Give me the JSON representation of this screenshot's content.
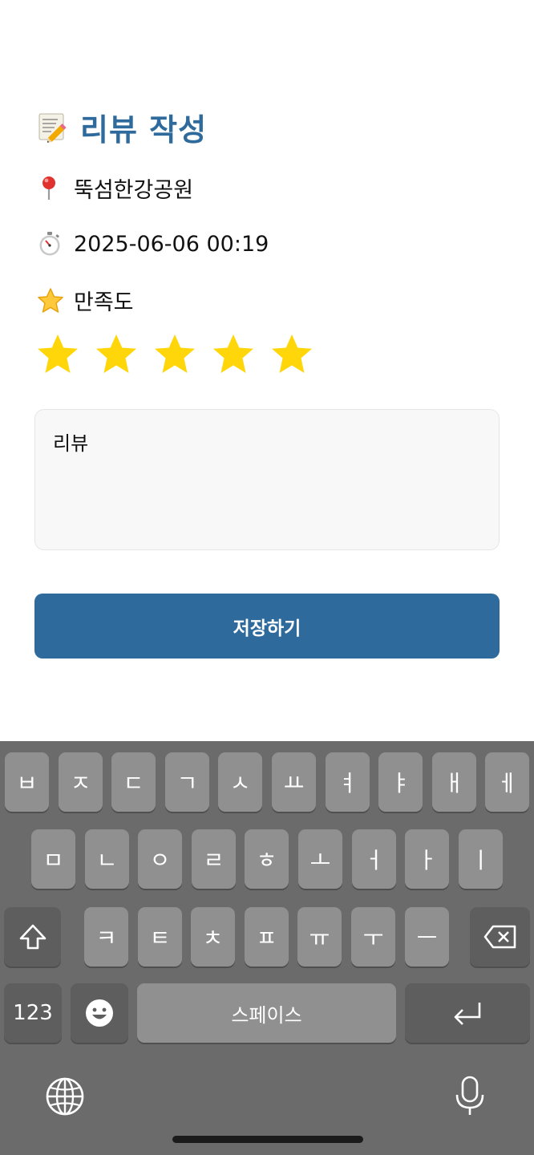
{
  "header": {
    "title": "리뷰 작성",
    "title_color": "#2E6A9B",
    "icon": "memo-icon"
  },
  "place": {
    "icon": "pin-icon",
    "name": "뚝섬한강공원"
  },
  "visit": {
    "icon": "stopwatch-icon",
    "datetime": "2025-06-06 00:19"
  },
  "satisfaction": {
    "icon": "star-icon",
    "label": "만족도",
    "rating": 5,
    "max": 5,
    "star_color": "#FFD60A"
  },
  "review": {
    "placeholder": "리뷰",
    "value": ""
  },
  "save_button": {
    "label": "저장하기",
    "color": "#2E6A9B"
  },
  "keyboard": {
    "row1": [
      "ㅂ",
      "ㅈ",
      "ㄷ",
      "ㄱ",
      "ㅅ",
      "ㅛ",
      "ㅕ",
      "ㅑ",
      "ㅐ",
      "ㅔ"
    ],
    "row2": [
      "ㅁ",
      "ㄴ",
      "ㅇ",
      "ㄹ",
      "ㅎ",
      "ㅗ",
      "ㅓ",
      "ㅏ",
      "ㅣ"
    ],
    "row3": [
      "ㅋ",
      "ㅌ",
      "ㅊ",
      "ㅍ",
      "ㅠ",
      "ㅜ",
      "ㅡ"
    ],
    "numbers_label": "123",
    "space_label": "스페이스",
    "shift_icon": "shift-icon",
    "delete_icon": "backspace-icon",
    "emoji_icon": "emoji-icon",
    "return_icon": "return-icon",
    "globe_icon": "globe-icon",
    "mic_icon": "microphone-icon"
  }
}
